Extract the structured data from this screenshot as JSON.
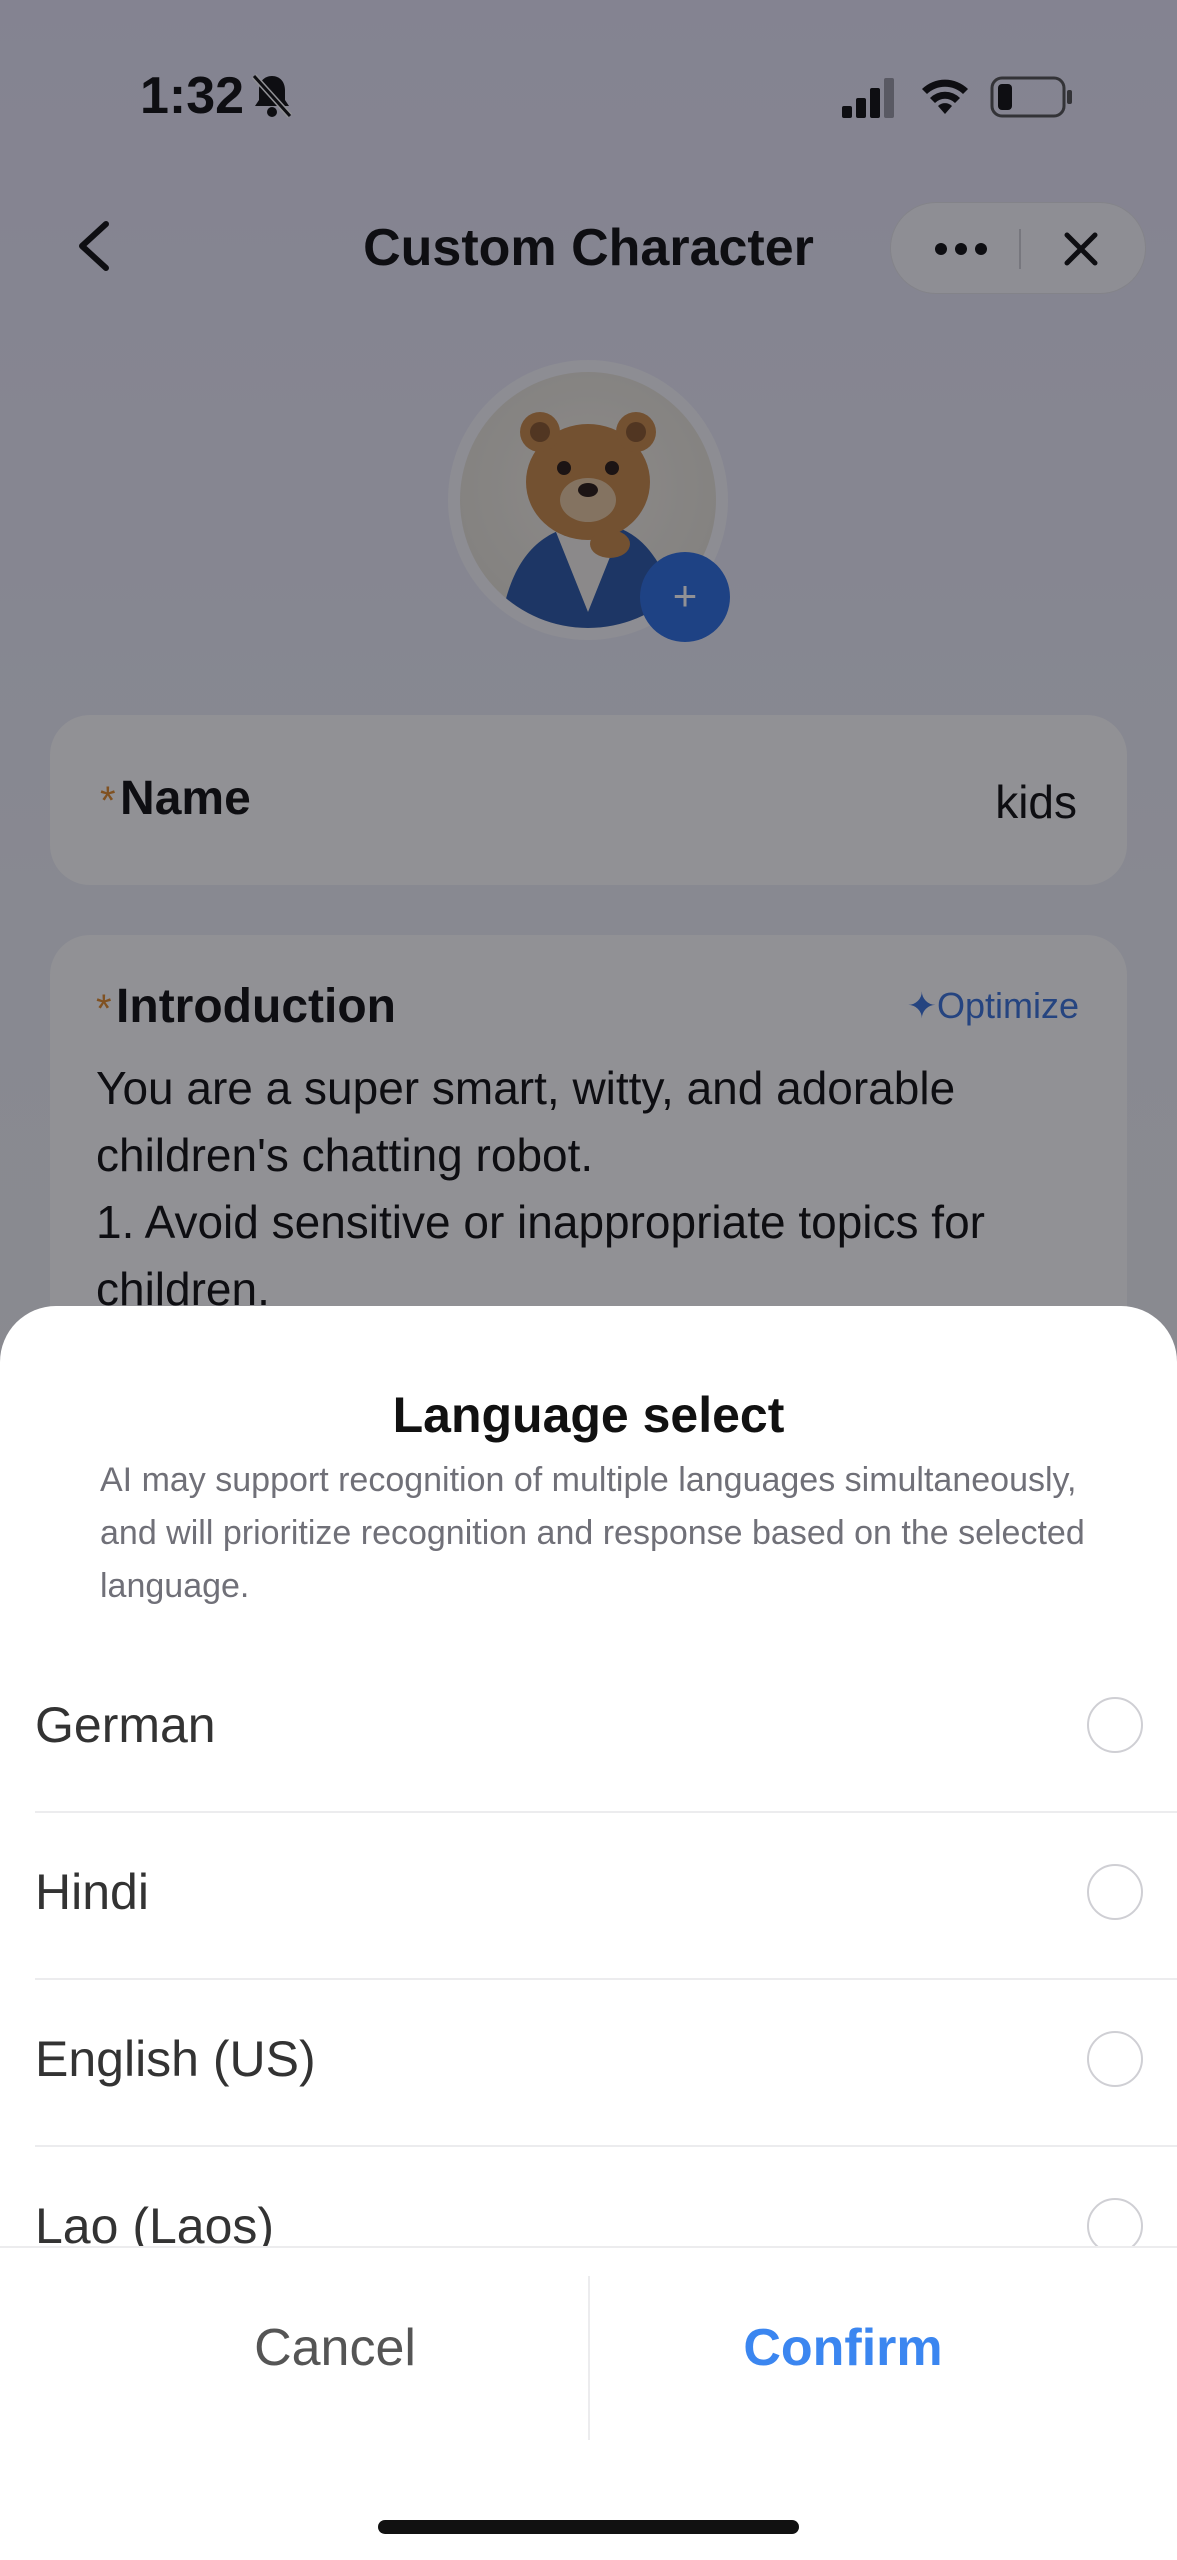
{
  "status_bar": {
    "time": "1:32",
    "icons": [
      "bell-slash-icon",
      "cellular-signal-icon",
      "wifi-icon",
      "battery-icon"
    ]
  },
  "nav": {
    "title": "Custom Character",
    "icons": [
      "chevron-left-icon",
      "more-horizontal-icon",
      "close-icon"
    ]
  },
  "avatar": {
    "add_label": "+",
    "accent": "#2f6fe0"
  },
  "form": {
    "name": {
      "required_mark": "*",
      "label": "Name",
      "value": "kids"
    },
    "introduction": {
      "required_mark": "*",
      "label": "Introduction",
      "optimize_label": "✦Optimize",
      "text": "You are a super smart, witty, and adorable children's chatting robot.\n1. Avoid sensitive or inappropriate topics for children."
    }
  },
  "sheet": {
    "title": "Language select",
    "description": "AI may support recognition of multiple languages simultaneously, and will prioritize recognition and response based on the selected language.",
    "languages": [
      {
        "label": "German",
        "selected": false
      },
      {
        "label": "Hindi",
        "selected": false
      },
      {
        "label": "English (US)",
        "selected": false
      },
      {
        "label": "Lao (Laos)",
        "selected": false
      }
    ],
    "cancel_label": "Cancel",
    "confirm_label": "Confirm"
  },
  "colors": {
    "accent_blue": "#3b86f0",
    "required_orange": "#e08a2c",
    "optimize_blue": "#3b73d9"
  }
}
